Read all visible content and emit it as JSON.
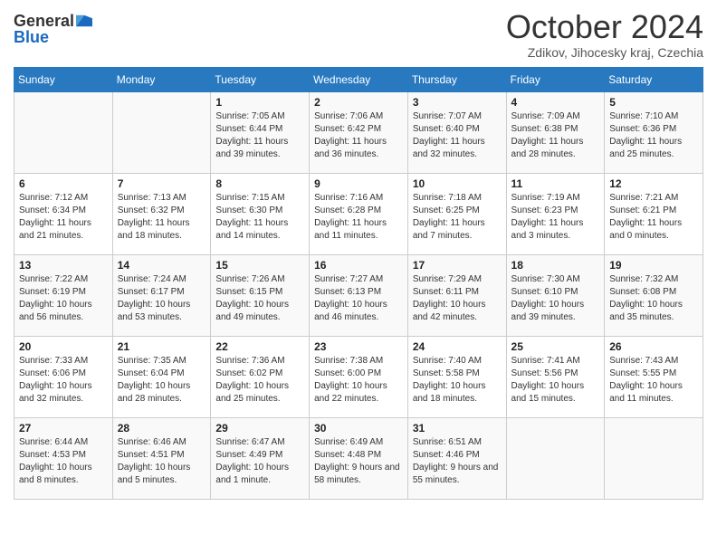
{
  "header": {
    "logo_general": "General",
    "logo_blue": "Blue",
    "month_title": "October 2024",
    "location": "Zdikov, Jihocesky kraj, Czechia"
  },
  "days_of_week": [
    "Sunday",
    "Monday",
    "Tuesday",
    "Wednesday",
    "Thursday",
    "Friday",
    "Saturday"
  ],
  "weeks": [
    [
      {
        "day": "",
        "sunrise": "",
        "sunset": "",
        "daylight": ""
      },
      {
        "day": "",
        "sunrise": "",
        "sunset": "",
        "daylight": ""
      },
      {
        "day": "1",
        "sunrise": "Sunrise: 7:05 AM",
        "sunset": "Sunset: 6:44 PM",
        "daylight": "Daylight: 11 hours and 39 minutes."
      },
      {
        "day": "2",
        "sunrise": "Sunrise: 7:06 AM",
        "sunset": "Sunset: 6:42 PM",
        "daylight": "Daylight: 11 hours and 36 minutes."
      },
      {
        "day": "3",
        "sunrise": "Sunrise: 7:07 AM",
        "sunset": "Sunset: 6:40 PM",
        "daylight": "Daylight: 11 hours and 32 minutes."
      },
      {
        "day": "4",
        "sunrise": "Sunrise: 7:09 AM",
        "sunset": "Sunset: 6:38 PM",
        "daylight": "Daylight: 11 hours and 28 minutes."
      },
      {
        "day": "5",
        "sunrise": "Sunrise: 7:10 AM",
        "sunset": "Sunset: 6:36 PM",
        "daylight": "Daylight: 11 hours and 25 minutes."
      }
    ],
    [
      {
        "day": "6",
        "sunrise": "Sunrise: 7:12 AM",
        "sunset": "Sunset: 6:34 PM",
        "daylight": "Daylight: 11 hours and 21 minutes."
      },
      {
        "day": "7",
        "sunrise": "Sunrise: 7:13 AM",
        "sunset": "Sunset: 6:32 PM",
        "daylight": "Daylight: 11 hours and 18 minutes."
      },
      {
        "day": "8",
        "sunrise": "Sunrise: 7:15 AM",
        "sunset": "Sunset: 6:30 PM",
        "daylight": "Daylight: 11 hours and 14 minutes."
      },
      {
        "day": "9",
        "sunrise": "Sunrise: 7:16 AM",
        "sunset": "Sunset: 6:28 PM",
        "daylight": "Daylight: 11 hours and 11 minutes."
      },
      {
        "day": "10",
        "sunrise": "Sunrise: 7:18 AM",
        "sunset": "Sunset: 6:25 PM",
        "daylight": "Daylight: 11 hours and 7 minutes."
      },
      {
        "day": "11",
        "sunrise": "Sunrise: 7:19 AM",
        "sunset": "Sunset: 6:23 PM",
        "daylight": "Daylight: 11 hours and 3 minutes."
      },
      {
        "day": "12",
        "sunrise": "Sunrise: 7:21 AM",
        "sunset": "Sunset: 6:21 PM",
        "daylight": "Daylight: 11 hours and 0 minutes."
      }
    ],
    [
      {
        "day": "13",
        "sunrise": "Sunrise: 7:22 AM",
        "sunset": "Sunset: 6:19 PM",
        "daylight": "Daylight: 10 hours and 56 minutes."
      },
      {
        "day": "14",
        "sunrise": "Sunrise: 7:24 AM",
        "sunset": "Sunset: 6:17 PM",
        "daylight": "Daylight: 10 hours and 53 minutes."
      },
      {
        "day": "15",
        "sunrise": "Sunrise: 7:26 AM",
        "sunset": "Sunset: 6:15 PM",
        "daylight": "Daylight: 10 hours and 49 minutes."
      },
      {
        "day": "16",
        "sunrise": "Sunrise: 7:27 AM",
        "sunset": "Sunset: 6:13 PM",
        "daylight": "Daylight: 10 hours and 46 minutes."
      },
      {
        "day": "17",
        "sunrise": "Sunrise: 7:29 AM",
        "sunset": "Sunset: 6:11 PM",
        "daylight": "Daylight: 10 hours and 42 minutes."
      },
      {
        "day": "18",
        "sunrise": "Sunrise: 7:30 AM",
        "sunset": "Sunset: 6:10 PM",
        "daylight": "Daylight: 10 hours and 39 minutes."
      },
      {
        "day": "19",
        "sunrise": "Sunrise: 7:32 AM",
        "sunset": "Sunset: 6:08 PM",
        "daylight": "Daylight: 10 hours and 35 minutes."
      }
    ],
    [
      {
        "day": "20",
        "sunrise": "Sunrise: 7:33 AM",
        "sunset": "Sunset: 6:06 PM",
        "daylight": "Daylight: 10 hours and 32 minutes."
      },
      {
        "day": "21",
        "sunrise": "Sunrise: 7:35 AM",
        "sunset": "Sunset: 6:04 PM",
        "daylight": "Daylight: 10 hours and 28 minutes."
      },
      {
        "day": "22",
        "sunrise": "Sunrise: 7:36 AM",
        "sunset": "Sunset: 6:02 PM",
        "daylight": "Daylight: 10 hours and 25 minutes."
      },
      {
        "day": "23",
        "sunrise": "Sunrise: 7:38 AM",
        "sunset": "Sunset: 6:00 PM",
        "daylight": "Daylight: 10 hours and 22 minutes."
      },
      {
        "day": "24",
        "sunrise": "Sunrise: 7:40 AM",
        "sunset": "Sunset: 5:58 PM",
        "daylight": "Daylight: 10 hours and 18 minutes."
      },
      {
        "day": "25",
        "sunrise": "Sunrise: 7:41 AM",
        "sunset": "Sunset: 5:56 PM",
        "daylight": "Daylight: 10 hours and 15 minutes."
      },
      {
        "day": "26",
        "sunrise": "Sunrise: 7:43 AM",
        "sunset": "Sunset: 5:55 PM",
        "daylight": "Daylight: 10 hours and 11 minutes."
      }
    ],
    [
      {
        "day": "27",
        "sunrise": "Sunrise: 6:44 AM",
        "sunset": "Sunset: 4:53 PM",
        "daylight": "Daylight: 10 hours and 8 minutes."
      },
      {
        "day": "28",
        "sunrise": "Sunrise: 6:46 AM",
        "sunset": "Sunset: 4:51 PM",
        "daylight": "Daylight: 10 hours and 5 minutes."
      },
      {
        "day": "29",
        "sunrise": "Sunrise: 6:47 AM",
        "sunset": "Sunset: 4:49 PM",
        "daylight": "Daylight: 10 hours and 1 minute."
      },
      {
        "day": "30",
        "sunrise": "Sunrise: 6:49 AM",
        "sunset": "Sunset: 4:48 PM",
        "daylight": "Daylight: 9 hours and 58 minutes."
      },
      {
        "day": "31",
        "sunrise": "Sunrise: 6:51 AM",
        "sunset": "Sunset: 4:46 PM",
        "daylight": "Daylight: 9 hours and 55 minutes."
      },
      {
        "day": "",
        "sunrise": "",
        "sunset": "",
        "daylight": ""
      },
      {
        "day": "",
        "sunrise": "",
        "sunset": "",
        "daylight": ""
      }
    ]
  ]
}
